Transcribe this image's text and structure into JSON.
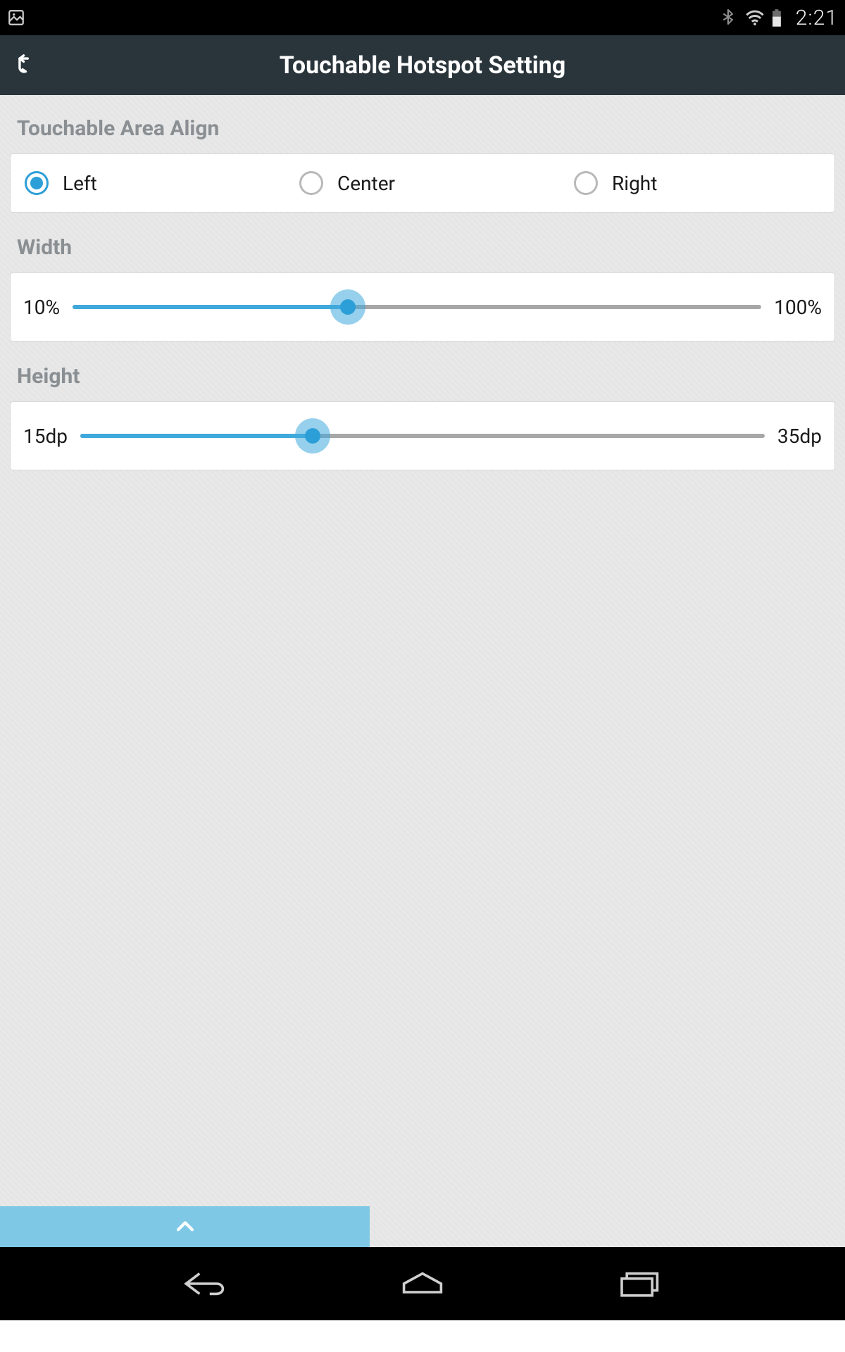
{
  "status": {
    "time": "2:21"
  },
  "appbar": {
    "title": "Touchable Hotspot Setting"
  },
  "sections": {
    "align": {
      "label": "Touchable Area Align",
      "options": [
        {
          "label": "Left",
          "selected": true
        },
        {
          "label": "Center",
          "selected": false
        },
        {
          "label": "Right",
          "selected": false
        }
      ]
    },
    "width": {
      "label": "Width",
      "min_label": "10%",
      "max_label": "100%",
      "value_pct": 40
    },
    "height": {
      "label": "Height",
      "min_label": "15dp",
      "max_label": "35dp",
      "value_pct": 34
    }
  },
  "colors": {
    "accent": "#2d9fd8",
    "accent_light": "#7ec8e6",
    "appbar_bg": "#2a343b",
    "content_bg": "#e8e8e8"
  }
}
